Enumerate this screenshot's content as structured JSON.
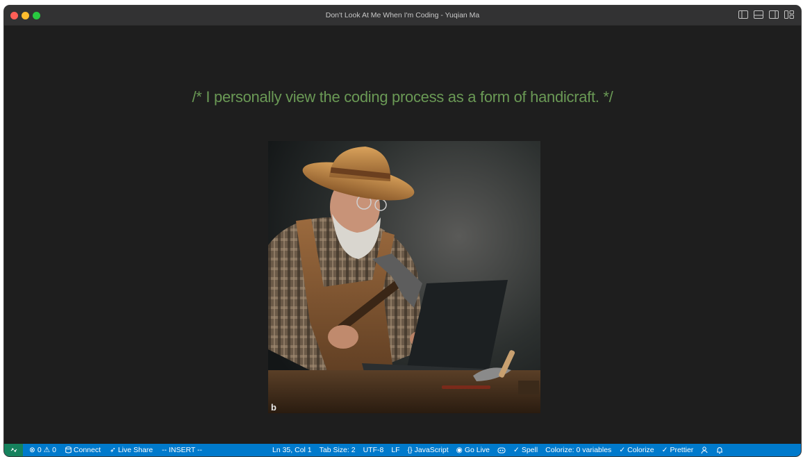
{
  "window": {
    "title": "Don't Look At Me When I'm Coding - Yuqian Ma"
  },
  "editor": {
    "comment": "/* I personally view the coding process as a form of handicraft. */",
    "image_watermark": "b"
  },
  "statusbar": {
    "remote_icon": "remote-icon",
    "problems_errors": "0",
    "problems_warnings": "0",
    "connect": "Connect",
    "live_share": "Live Share",
    "mode": "-- INSERT --",
    "position": "Ln 35, Col 1",
    "tab_size": "Tab Size: 2",
    "encoding": "UTF-8",
    "eol": "LF",
    "language": "JavaScript",
    "go_live": "Go Live",
    "spell": "Spell",
    "colorize_vars": "Colorize: 0 variables",
    "colorize": "Colorize",
    "prettier": "Prettier"
  },
  "colors": {
    "status_bar": "#007acc",
    "remote_bg": "#16825d",
    "comment": "#6a9955",
    "editor_bg": "#1e1e1e"
  }
}
